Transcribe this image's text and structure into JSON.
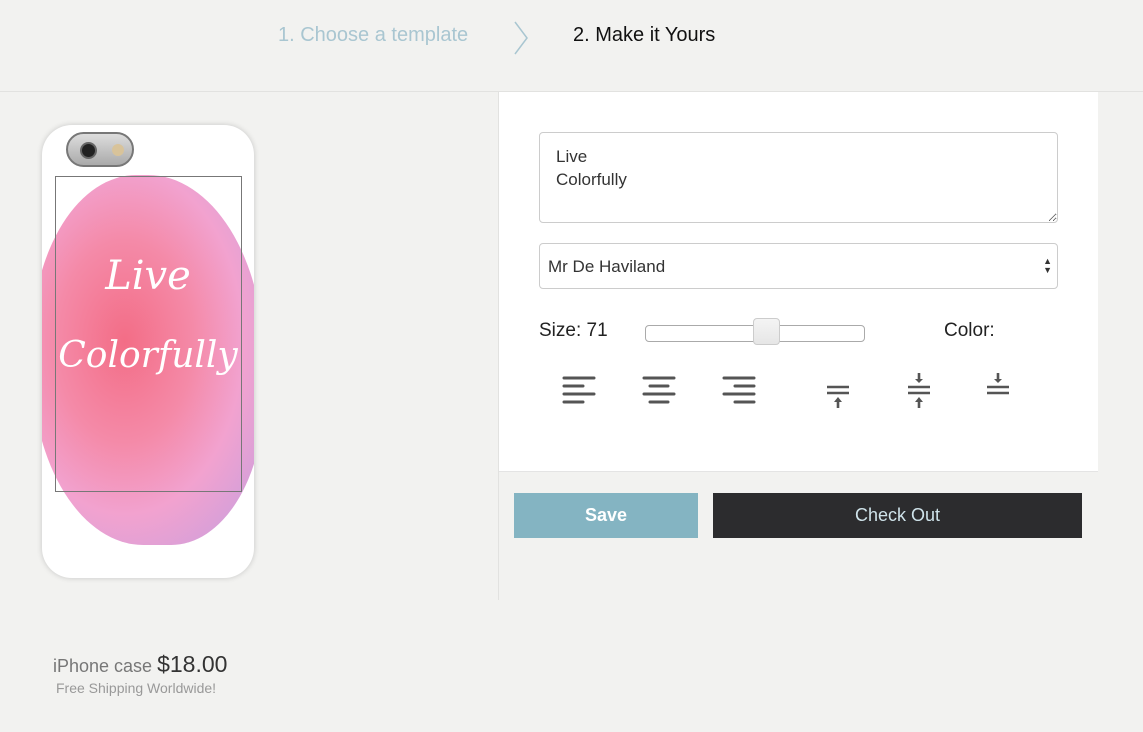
{
  "steps": [
    {
      "label": "1. Choose a template"
    },
    {
      "label": "2. Make it Yours"
    }
  ],
  "editor": {
    "text_value": "Live\nColorfully",
    "font_selected": "Mr De Haviland",
    "size_label": "Size: 71",
    "size_value": 71,
    "color_label": "Color:",
    "align_icons": [
      "align-left-icon",
      "align-center-icon",
      "align-right-icon"
    ],
    "valign_icons": [
      "valign-top-icon",
      "valign-middle-icon",
      "valign-bottom-icon"
    ]
  },
  "buttons": {
    "save": "Save",
    "checkout": "Check Out"
  },
  "preview": {
    "line1": "Live",
    "line2": "Colorfully"
  },
  "product": {
    "name": "iPhone case",
    "price": "$18.00",
    "shipping": "Free Shipping Worldwide!"
  },
  "colors": {
    "accent": "#84b4c2",
    "dark": "#2c2c2e",
    "step_inactive": "#a9c6d1"
  }
}
